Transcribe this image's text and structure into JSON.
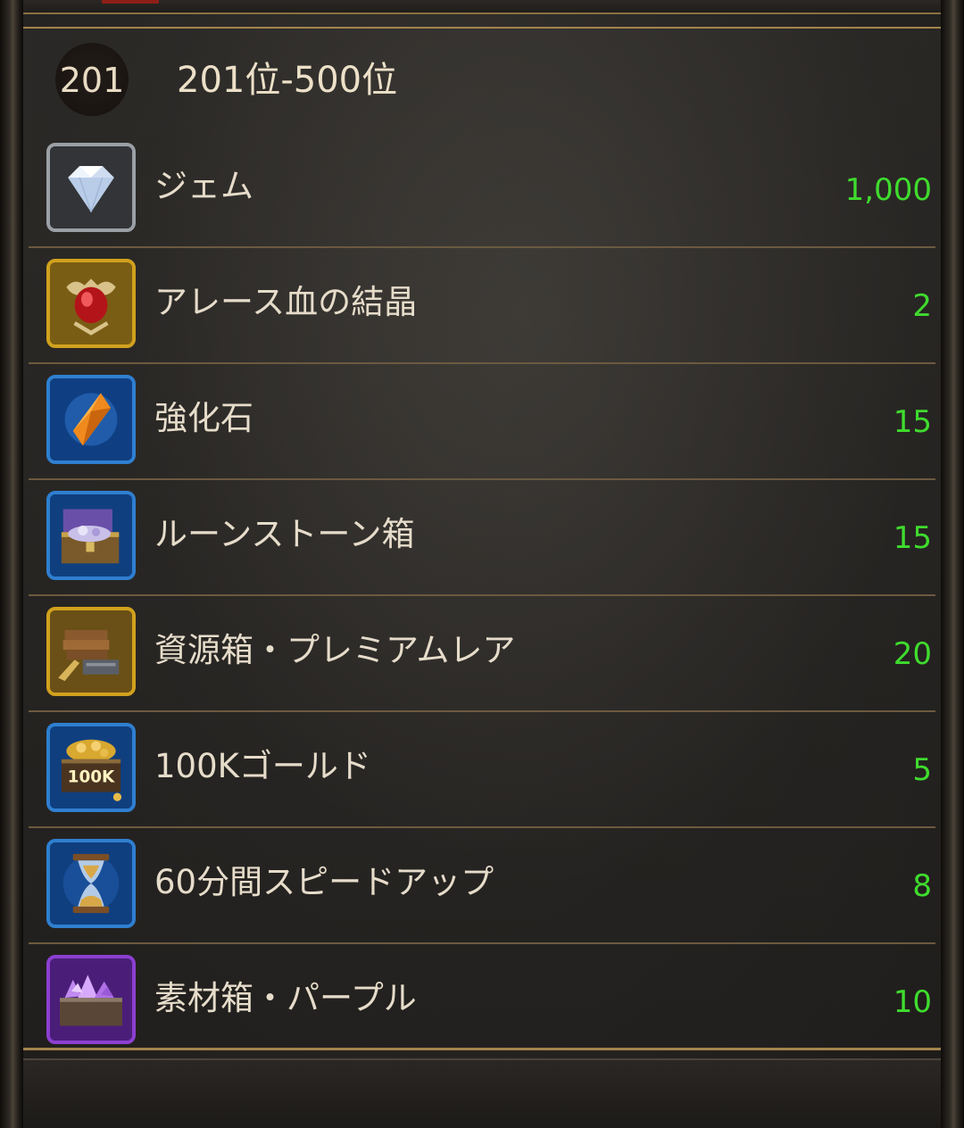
{
  "rank": {
    "badge": "201",
    "title": "201位-500位"
  },
  "rewards": [
    {
      "name": "ジェム",
      "quantity": "1,000",
      "icon": "diamond-icon",
      "frame_color": "#9aa0a6"
    },
    {
      "name": "アレース血の結晶",
      "quantity": "2",
      "icon": "blood-crystal-icon",
      "frame_color": "#d1a11e"
    },
    {
      "name": "強化石",
      "quantity": "15",
      "icon": "enhancement-stone-icon",
      "frame_color": "#2f7fd0"
    },
    {
      "name": "ルーンストーン箱",
      "quantity": "15",
      "icon": "runestone-chest-icon",
      "frame_color": "#2f7fd0"
    },
    {
      "name": "資源箱・プレミアムレア",
      "quantity": "20",
      "icon": "resource-box-icon",
      "frame_color": "#d1a11e"
    },
    {
      "name": "100Kゴールド",
      "quantity": "5",
      "icon": "gold-chest-icon",
      "frame_color": "#2f7fd0",
      "icon_label": "100K"
    },
    {
      "name": "60分間スピードアップ",
      "quantity": "8",
      "icon": "hourglass-icon",
      "frame_color": "#2f7fd0"
    },
    {
      "name": "素材箱・パープル",
      "quantity": "10",
      "icon": "material-box-purple-icon",
      "frame_color": "#8c3fd0"
    }
  ],
  "colors": {
    "quantity_text": "#3fdc2e",
    "gold_border": "#a3844c"
  }
}
